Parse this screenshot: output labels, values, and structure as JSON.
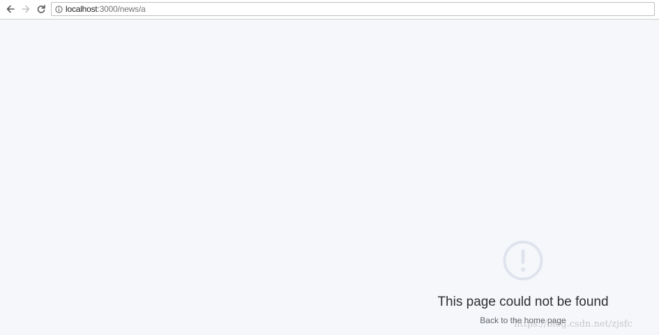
{
  "browser": {
    "url_host": "localhost",
    "url_path": ":3000/news/a",
    "icons": {
      "back": "arrow-left-icon",
      "forward": "arrow-right-icon",
      "reload": "reload-icon",
      "info": "info-icon"
    }
  },
  "error_page": {
    "icon": "exclamation-circle-icon",
    "title": "This page could not be found",
    "link_text": "Back to the home page"
  },
  "watermark": {
    "text": "https://blog.csdn.net/zjsfc"
  },
  "colors": {
    "page_background": "#f5f7fb",
    "icon_color": "#dfe3ec",
    "title_color": "#2d2f33"
  }
}
